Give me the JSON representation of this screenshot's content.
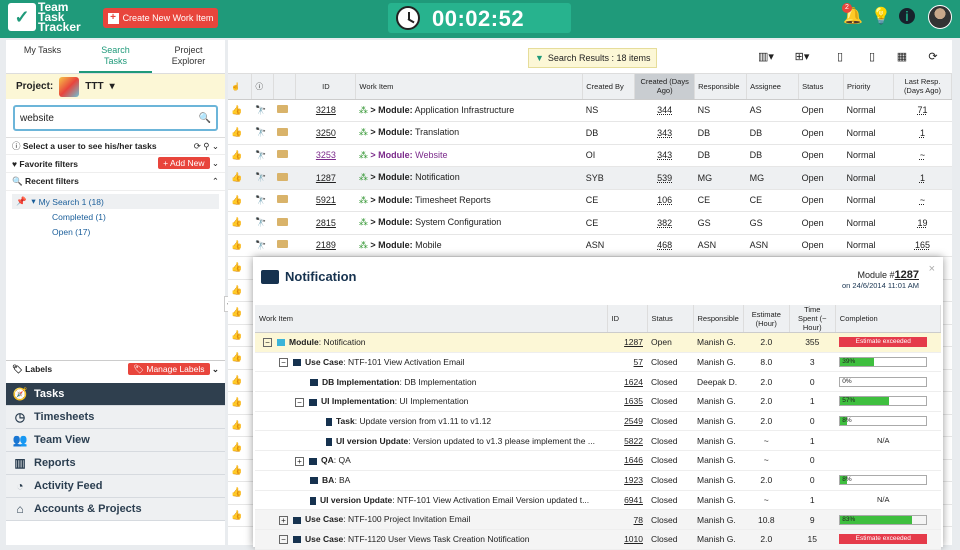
{
  "app": {
    "logo_lines": [
      "Team",
      "Task",
      "Tracker"
    ],
    "create_label": "Create New Work Item",
    "timer": "00:02:52",
    "bell_count": "2"
  },
  "left": {
    "tabs": [
      "My Tasks",
      "Search Tasks",
      "Project Explorer"
    ],
    "project_label": "Project:",
    "project_name": "TTT",
    "search_value": "website",
    "select_user": "Select a user to see his/her tasks",
    "favorite_filters": "Favorite filters",
    "add_new": "Add New",
    "recent_filters": "Recent filters",
    "tree": [
      {
        "label": "My Search 1 (18)"
      },
      {
        "label": "Completed (1)"
      },
      {
        "label": "Open (17)"
      }
    ],
    "labels": "Labels",
    "manage_labels": "Manage Labels",
    "nav": [
      {
        "label": "Tasks",
        "icon": "tasks-icon"
      },
      {
        "label": "Timesheets",
        "icon": "clock-icon"
      },
      {
        "label": "Team View",
        "icon": "team-icon"
      },
      {
        "label": "Reports",
        "icon": "reports-icon"
      },
      {
        "label": "Activity Feed",
        "icon": "rss-icon"
      },
      {
        "label": "Accounts & Projects",
        "icon": "home-icon"
      }
    ]
  },
  "toolbar": {
    "search_results": "Search Results : 18 items"
  },
  "grid": {
    "headers": [
      "ID",
      "Work Item",
      "Created By",
      "Created (Days Ago)",
      "Responsible",
      "Assignee",
      "Status",
      "Priority",
      "Last Resp. (Days Ago)"
    ],
    "rows": [
      {
        "id": "3218",
        "type": "Module",
        "title": "Application Infrastructure",
        "created_by": "NS",
        "created": "344",
        "responsible": "NS",
        "assignee": "AS",
        "status": "Open",
        "priority": "Normal",
        "last": "71"
      },
      {
        "id": "3250",
        "type": "Module",
        "title": "Translation",
        "created_by": "DB",
        "created": "343",
        "responsible": "DB",
        "assignee": "DB",
        "status": "Open",
        "priority": "Normal",
        "last": "1"
      },
      {
        "id": "3253",
        "type": "Module",
        "title": "Website",
        "created_by": "OI",
        "created": "343",
        "responsible": "DB",
        "assignee": "DB",
        "status": "Open",
        "priority": "Normal",
        "last": "~"
      },
      {
        "id": "1287",
        "type": "Module",
        "title": "Notification",
        "created_by": "SYB",
        "created": "539",
        "responsible": "MG",
        "assignee": "MG",
        "status": "Open",
        "priority": "Normal",
        "last": "1"
      },
      {
        "id": "5921",
        "type": "Module",
        "title": "Timesheet Reports",
        "created_by": "CE",
        "created": "106",
        "responsible": "CE",
        "assignee": "CE",
        "status": "Open",
        "priority": "Normal",
        "last": "~"
      },
      {
        "id": "2815",
        "type": "Module",
        "title": "System Configuration",
        "created_by": "CE",
        "created": "382",
        "responsible": "GS",
        "assignee": "GS",
        "status": "Open",
        "priority": "Normal",
        "last": "19"
      },
      {
        "id": "2189",
        "type": "Module",
        "title": "Mobile",
        "created_by": "ASN",
        "created": "468",
        "responsible": "ASN",
        "assignee": "ASN",
        "status": "Open",
        "priority": "Normal",
        "last": "165"
      }
    ]
  },
  "popup": {
    "title": "Notification",
    "module_label": "Module #",
    "module_num": "1287",
    "date": "on 24/6/2014 11:01 AM",
    "headers": [
      "Work Item",
      "ID",
      "Status",
      "Responsible",
      "Estimate (Hour)",
      "Time Spent (~ Hour)",
      "Completion"
    ],
    "rows": [
      {
        "type": "Module",
        "title": "Notification",
        "id": "1287",
        "status": "Open",
        "resp": "Manish G.",
        "est": "2.0",
        "spent": "355",
        "completion": "Estimate exceeded",
        "pct": null
      },
      {
        "type": "Use Case",
        "title": "NTF-101 View Activation Email",
        "id": "57",
        "status": "Closed",
        "resp": "Manish G.",
        "est": "8.0",
        "spent": "3",
        "completion": "39%",
        "pct": 39
      },
      {
        "type": "DB Implementation",
        "title": "DB Implementation",
        "id": "1624",
        "status": "Closed",
        "resp": "Deepak D.",
        "est": "2.0",
        "spent": "0",
        "completion": "0%",
        "pct": 0
      },
      {
        "type": "UI Implementation",
        "title": "UI Implementation",
        "id": "1635",
        "status": "Closed",
        "resp": "Manish G.",
        "est": "2.0",
        "spent": "1",
        "completion": "57%",
        "pct": 57
      },
      {
        "type": "Task",
        "title": "Update version from v1.11 to v1.12",
        "id": "2549",
        "status": "Closed",
        "resp": "Manish G.",
        "est": "2.0",
        "spent": "0",
        "completion": "8%",
        "pct": 8
      },
      {
        "type": "UI version Update",
        "title": "Version updated to v1.3 please implement the ...",
        "id": "5822",
        "status": "Closed",
        "resp": "Manish G.",
        "est": "~",
        "spent": "1",
        "completion": "N/A",
        "pct": null
      },
      {
        "type": "QA",
        "title": "QA",
        "id": "1646",
        "status": "Closed",
        "resp": "Manish G.",
        "est": "~",
        "spent": "0",
        "completion": "",
        "pct": null
      },
      {
        "type": "BA",
        "title": "BA",
        "id": "1923",
        "status": "Closed",
        "resp": "Manish G.",
        "est": "2.0",
        "spent": "0",
        "completion": "8%",
        "pct": 8
      },
      {
        "type": "UI version Update",
        "title": "NTF-101 View Activation Email Version updated t...",
        "id": "6941",
        "status": "Closed",
        "resp": "Manish G.",
        "est": "~",
        "spent": "1",
        "completion": "N/A",
        "pct": null
      },
      {
        "type": "Use Case",
        "title": "NTF-100 Project Invitation Email",
        "id": "78",
        "status": "Closed",
        "resp": "Manish G.",
        "est": "10.8",
        "spent": "9",
        "completion": "83%",
        "pct": 83
      },
      {
        "type": "Use Case",
        "title": "NTF-1120 User Views Task Creation Notification",
        "id": "1010",
        "status": "Closed",
        "resp": "Manish G.",
        "est": "2.0",
        "spent": "15",
        "completion": "Estimate exceeded",
        "pct": null
      }
    ]
  }
}
